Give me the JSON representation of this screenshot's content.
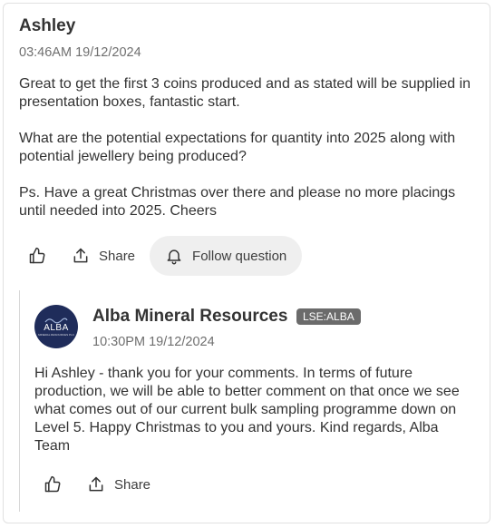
{
  "question": {
    "author": "Ashley",
    "timestamp": "03:46AM 19/12/2024",
    "paragraphs": [
      "Great to get the first 3 coins produced and as stated will be supplied in presentation boxes, fantastic start.",
      "What are the potential expectations for quantity into 2025 along with potential jewellery being produced?",
      "Ps. Have a great Christmas over there and please no more placings until needed into 2025. Cheers"
    ],
    "actions": {
      "like_icon": "thumbs-up-icon",
      "share_label": "Share",
      "share_icon": "share-icon",
      "follow_label": "Follow question",
      "follow_icon": "bell-icon"
    }
  },
  "reply": {
    "author": "Alba Mineral Resources",
    "ticker": "LSE:ALBA",
    "timestamp": "10:30PM 19/12/2024",
    "logo_text": "ALBA",
    "logo_subtext": "MINERAL RESOURCES PLC",
    "body": "Hi Ashley  - thank you for your comments.  In terms of future production, we will be able to better comment on that once we see what comes out of our current bulk sampling programme down on Level 5.  Happy Christmas to you and yours.  Kind regards, Alba Team",
    "actions": {
      "like_icon": "thumbs-up-icon",
      "share_label": "Share",
      "share_icon": "share-icon"
    }
  },
  "colors": {
    "logo_bg": "#1f2c5a",
    "badge_bg": "#6b6b6b",
    "follow_bg": "#efefef"
  }
}
